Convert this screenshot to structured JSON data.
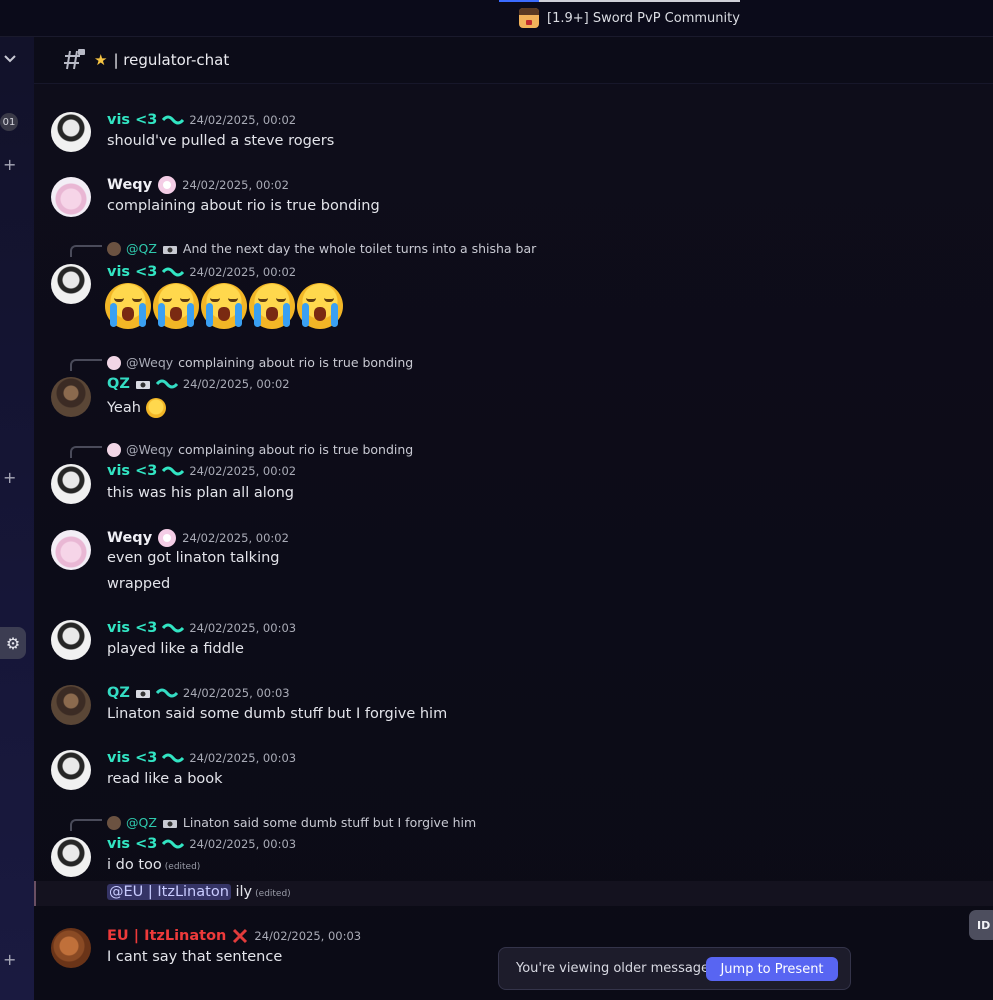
{
  "server": {
    "name": "[1.9+] Sword PvP Community"
  },
  "channel": {
    "name": "| regulator-chat",
    "star": "★"
  },
  "rail": {
    "badge": "01",
    "plus": "+",
    "gear": "⚙",
    "chevron": "⌄"
  },
  "messages": [
    {
      "author": "vis <3",
      "timestamp": "24/02/2025, 00:02",
      "text": "should've pulled a steve rogers"
    },
    {
      "author": "Weqy",
      "timestamp": "24/02/2025, 00:02",
      "text": "complaining about rio is true bonding"
    },
    {
      "reply_to": "@QZ",
      "reply_text": "And the next day the whole toilet turns into a shisha bar",
      "author": "vis <3",
      "timestamp": "24/02/2025, 00:02",
      "emoji_count": 5,
      "emoji_name": "loudly-crying-face"
    },
    {
      "reply_to": "@Weqy",
      "reply_text": "complaining about rio is true bonding",
      "author": "QZ",
      "timestamp": "24/02/2025, 00:02",
      "text": "Yeah"
    },
    {
      "reply_to": "@Weqy",
      "reply_text": "complaining about rio is true bonding",
      "author": "vis <3",
      "timestamp": "24/02/2025, 00:02",
      "text": "this was his plan all along"
    },
    {
      "author": "Weqy",
      "timestamp": "24/02/2025, 00:02",
      "text": "even got linaton talking",
      "text2": "wrapped"
    },
    {
      "author": "vis <3",
      "timestamp": "24/02/2025, 00:03",
      "text": "played like a fiddle"
    },
    {
      "author": "QZ",
      "timestamp": "24/02/2025, 00:03",
      "text": "Linaton said some dumb stuff but I forgive him"
    },
    {
      "author": "vis <3",
      "timestamp": "24/02/2025, 00:03",
      "text": "read like a book"
    },
    {
      "reply_to": "@QZ",
      "reply_text": "Linaton said some dumb stuff but I forgive him",
      "author": "vis <3",
      "timestamp": "24/02/2025, 00:03",
      "text": "i do too",
      "edited": "(edited)",
      "mention": "@EU | ItzLinaton",
      "text2": "ily",
      "edited2": "(edited)"
    },
    {
      "author": "EU | ItzLinaton",
      "timestamp": "24/02/2025, 00:03",
      "text": "I cant say that sentence"
    }
  ],
  "side_pill": {
    "label": "ID"
  },
  "older_bar": {
    "text": "You're viewing older messages",
    "button": "Jump to Present"
  },
  "colors": {
    "accent": "#5865f2",
    "vis": "#32e5c3",
    "qz": "#34dcc3",
    "linaton": "#ee3a3a"
  }
}
